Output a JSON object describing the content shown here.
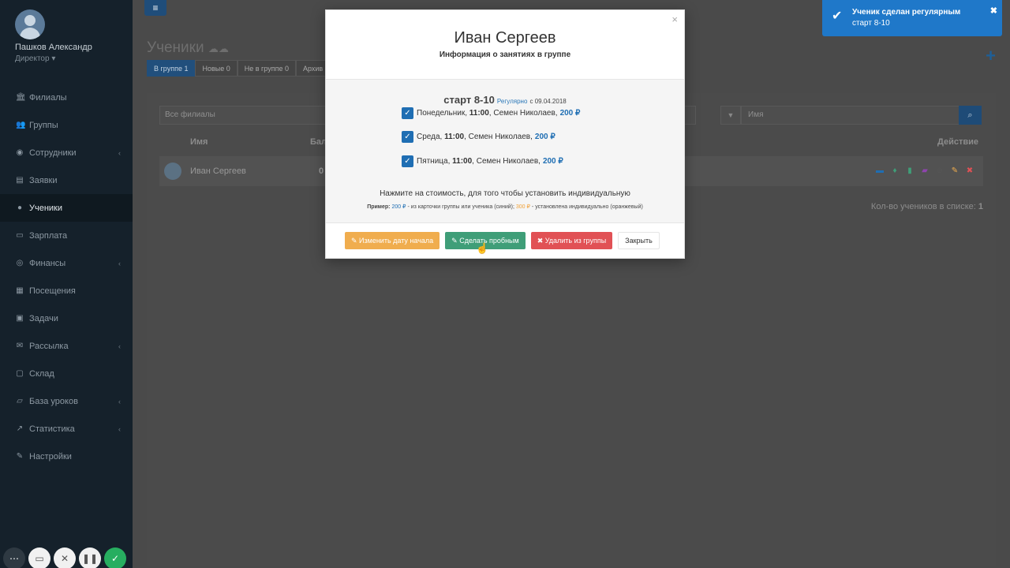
{
  "sidebar": {
    "profile": {
      "name": "Пашков Александр",
      "role": "Директор ▾"
    },
    "items": [
      {
        "label": "Филиалы",
        "icon": "bank-icon",
        "glyph": "🏛",
        "chevron": ""
      },
      {
        "label": "Группы",
        "icon": "users-icon",
        "glyph": "👥",
        "chevron": ""
      },
      {
        "label": "Сотрудники",
        "icon": "user-circle-icon",
        "glyph": "◉",
        "chevron": "‹"
      },
      {
        "label": "Заявки",
        "icon": "book-icon",
        "glyph": "▤",
        "chevron": ""
      },
      {
        "label": "Ученики",
        "icon": "user-icon",
        "glyph": "●",
        "chevron": ""
      },
      {
        "label": "Зарплата",
        "icon": "money-icon",
        "glyph": "▭",
        "chevron": ""
      },
      {
        "label": "Финансы",
        "icon": "coins-icon",
        "glyph": "◎",
        "chevron": "‹"
      },
      {
        "label": "Посещения",
        "icon": "calendar-icon",
        "glyph": "▦",
        "chevron": ""
      },
      {
        "label": "Задачи",
        "icon": "tasks-icon",
        "glyph": "▣",
        "chevron": ""
      },
      {
        "label": "Рассылка",
        "icon": "envelope-icon",
        "glyph": "✉",
        "chevron": "‹"
      },
      {
        "label": "Склад",
        "icon": "box-icon",
        "glyph": "▢",
        "chevron": ""
      },
      {
        "label": "База уроков",
        "icon": "folder-icon",
        "glyph": "▱",
        "chevron": "‹"
      },
      {
        "label": "Статистика",
        "icon": "chart-icon",
        "glyph": "↗",
        "chevron": "‹"
      },
      {
        "label": "Настройки",
        "icon": "wrench-icon",
        "glyph": "✎",
        "chevron": ""
      }
    ]
  },
  "bottom_bar": [
    {
      "icon": "more-icon",
      "glyph": "⋯"
    },
    {
      "icon": "video-icon",
      "glyph": "▭"
    },
    {
      "icon": "close-icon",
      "glyph": "✕"
    },
    {
      "icon": "pause-icon",
      "glyph": "❚❚"
    },
    {
      "icon": "check-icon",
      "glyph": "✓"
    }
  ],
  "page": {
    "title": "Ученики",
    "title_icons": "☁☁",
    "tabs": [
      {
        "label": "В группе 1"
      },
      {
        "label": "Новые 0"
      },
      {
        "label": "Не в группе 0"
      },
      {
        "label": "Архив"
      }
    ],
    "filter_value": "Все филиалы",
    "search_placeholder": "Имя",
    "table_headers": {
      "name": "Имя",
      "balance": "Бал",
      "action": "Действие"
    },
    "row": {
      "name": "Иван Сергеев",
      "balance": "0"
    },
    "count_label": "Кол-во учеников в списке:",
    "count_value": "1"
  },
  "modal": {
    "title": "Иван Сергеев",
    "subtitle": "Информация о занятиях в группе",
    "group_name": "старт 8-10",
    "group_reg": "Регулярно",
    "group_date": "с 09.04.2018",
    "lessons": [
      {
        "day": "Понедельник,",
        "time": "11:00",
        "teacher": ", Семен Николаев,",
        "price": "200 ₽"
      },
      {
        "day": "Среда,",
        "time": "11:00",
        "teacher": ", Семен Николаев,",
        "price": "200 ₽"
      },
      {
        "day": "Пятница,",
        "time": "11:00",
        "teacher": ", Семен Николаев,",
        "price": "200 ₽"
      }
    ],
    "hint": "Нажмите на стоимость, для того чтобы установить индивидуальную",
    "example": {
      "label": "Пример:",
      "blue_price": "200 ₽",
      "blue_text": " - из карточки группы или ученика (синий);",
      "orange_price": "300 ₽",
      "orange_text": " - установлена индивидуально (оранжевый)"
    },
    "buttons": {
      "change_date": "✎ Изменить дату начала",
      "make_trial": "✎ Сделать пробным",
      "remove": "✖ Удалить из группы",
      "close": "Закрыть"
    }
  },
  "toast": {
    "title": "Ученик сделан регулярным",
    "message": "старт 8-10"
  },
  "colors": {
    "accent": "#1f6eb3",
    "success": "#3f9e78",
    "danger": "#e15155",
    "warning": "#f0ad4e",
    "toast": "#1f78c9"
  }
}
